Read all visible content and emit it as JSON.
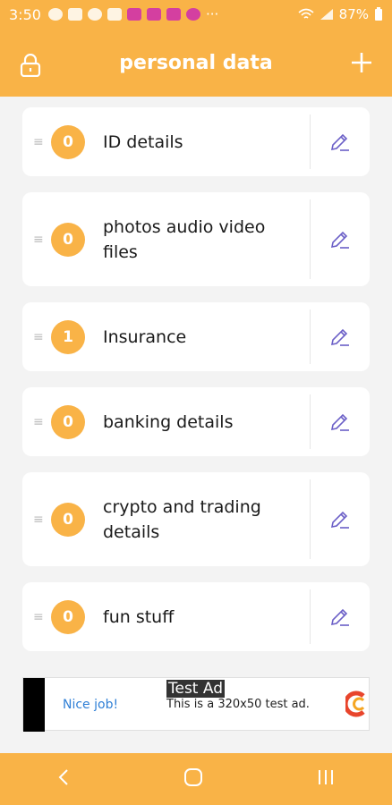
{
  "status": {
    "time": "3:50",
    "battery": "87%"
  },
  "header": {
    "title": "personal data"
  },
  "items": [
    {
      "count": "0",
      "label": "ID details"
    },
    {
      "count": "0",
      "label": "photos audio video files"
    },
    {
      "count": "1",
      "label": "Insurance"
    },
    {
      "count": "0",
      "label": "banking details"
    },
    {
      "count": "0",
      "label": "crypto and trading details"
    },
    {
      "count": "0",
      "label": "fun stuff"
    }
  ],
  "ad": {
    "nice": "Nice job!",
    "title": "Test Ad",
    "description": "This is a 320x50 test ad."
  },
  "colors": {
    "accent": "#f9b347",
    "edit_icon": "#6b5fc7"
  },
  "icons": {
    "header_left": "lock-icon",
    "header_right": "plus-icon",
    "row_action": "edit-pencil-icon",
    "nav": [
      "back-icon",
      "home-icon",
      "recents-icon"
    ]
  }
}
